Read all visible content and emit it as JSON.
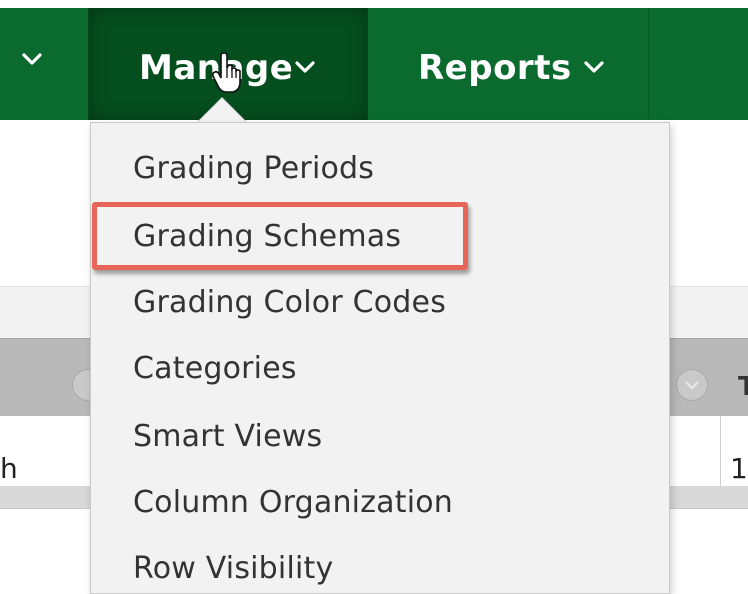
{
  "navbar": {
    "items": [
      {
        "label": ""
      },
      {
        "label": "Manage"
      },
      {
        "label": "Reports"
      }
    ]
  },
  "dropdown": {
    "items": [
      {
        "label": "Grading Periods"
      },
      {
        "label": "Grading Schemas"
      },
      {
        "label": "Grading Color Codes"
      },
      {
        "label": "Categories"
      },
      {
        "label": "Smart Views"
      },
      {
        "label": "Column Organization"
      },
      {
        "label": "Row Visibility"
      }
    ],
    "highlighted_index": 1
  },
  "background": {
    "header_partial_text": "T",
    "row_left_text": "h",
    "row_right_text": "1"
  },
  "colors": {
    "nav_bg": "#0b6a2e",
    "nav_active_bg": "#054f1e",
    "highlight_border": "#e8655a",
    "menu_bg": "#f2f2f2"
  }
}
